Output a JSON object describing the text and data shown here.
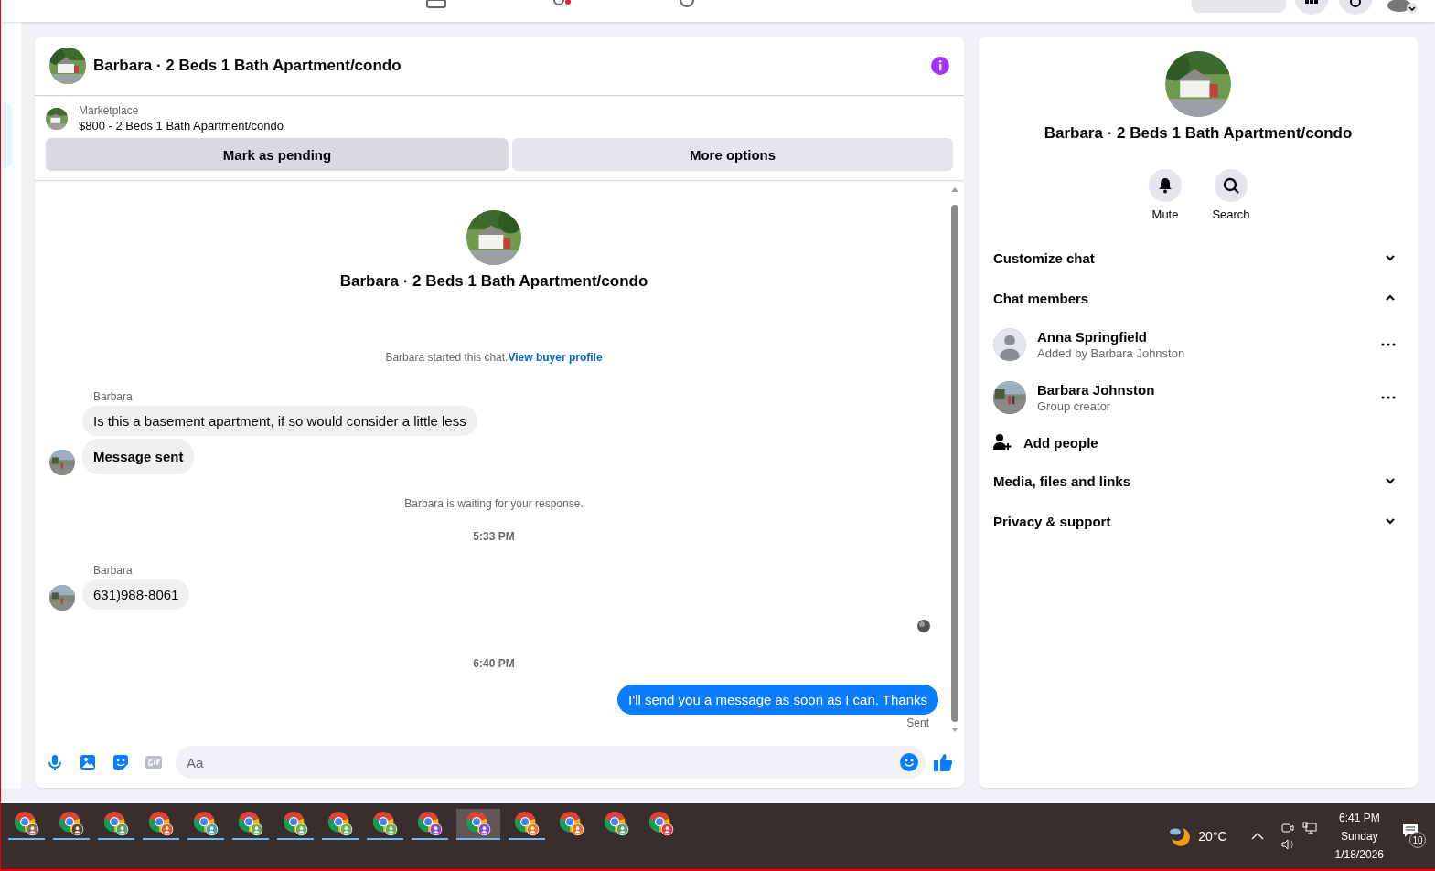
{
  "chat": {
    "title": "Barbara · 2 Beds 1 Bath Apartment/condo",
    "listing": {
      "source": "Marketplace",
      "summary": "$800 - 2 Beds 1 Bath Apartment/condo"
    },
    "actions": [
      {
        "label": "Mark as pending",
        "primary": true
      },
      {
        "label": "More options",
        "primary": false
      }
    ],
    "intro_title": "Barbara · 2 Beds 1 Bath Apartment/condo",
    "messages": [
      {
        "kind": "system",
        "text": "Barbara started this chat.",
        "link": "View buyer profile"
      },
      {
        "kind": "sender",
        "text": "Barbara"
      },
      {
        "kind": "received",
        "text": "Is this a basement apartment, if so would consider a little less"
      },
      {
        "kind": "received",
        "text": "Message sent",
        "bold": true
      },
      {
        "kind": "system",
        "text": "Barbara is waiting for your response."
      },
      {
        "kind": "time",
        "text": "5:33 PM"
      },
      {
        "kind": "sender",
        "text": "Barbara"
      },
      {
        "kind": "received",
        "text": "631)988-8061"
      },
      {
        "kind": "seen"
      },
      {
        "kind": "time",
        "text": "6:40 PM"
      },
      {
        "kind": "sent",
        "text": "I'll send you a message as soon as I can. Thanks"
      },
      {
        "kind": "status",
        "text": "Sent"
      }
    ],
    "composer": {
      "value": "Aa"
    }
  },
  "details": {
    "title": "Barbara · 2 Beds 1 Bath Apartment/condo",
    "quick_actions": [
      {
        "label": "Mute",
        "kind": "bell"
      },
      {
        "label": "Search",
        "kind": "search"
      }
    ],
    "sections": [
      {
        "label": "Customize chat",
        "expanded": false
      },
      {
        "label": "Chat members",
        "expanded": true,
        "members": [
          {
            "name": "Anna Springfield",
            "note": "Added by Barbara Johnston",
            "photo": false
          },
          {
            "name": "Barbara Johnston",
            "note": "Group creator",
            "photo": true
          }
        ],
        "add_label": "Add people"
      },
      {
        "label": "Media, files and links",
        "expanded": false
      },
      {
        "label": "Privacy & support",
        "expanded": false
      }
    ]
  },
  "taskbar": {
    "apps": [
      {
        "running": true,
        "selected": false,
        "color": "#8a6a50"
      },
      {
        "running": true,
        "selected": false,
        "color": "#5a4030"
      },
      {
        "running": true,
        "selected": false,
        "color": "#5aa06a"
      },
      {
        "running": true,
        "selected": false,
        "color": "#e05a3a"
      },
      {
        "running": true,
        "selected": false,
        "color": "#4aa0b0"
      },
      {
        "running": true,
        "selected": false,
        "color": "#6ab05a"
      },
      {
        "running": true,
        "selected": false,
        "color": "#6ab05a"
      },
      {
        "running": true,
        "selected": false,
        "color": "#6ab05a"
      },
      {
        "running": true,
        "selected": false,
        "color": "#6ab05a"
      },
      {
        "running": true,
        "selected": false,
        "color": "#8a4ad0"
      },
      {
        "running": true,
        "selected": true,
        "color": "#8a4ad0"
      },
      {
        "running": true,
        "selected": false,
        "color": "#e07a2a"
      },
      {
        "running": false,
        "selected": false,
        "color": "#e07a2a"
      },
      {
        "running": false,
        "selected": false,
        "color": "#5aa06a"
      },
      {
        "running": false,
        "selected": false,
        "color": "#e03a4a"
      }
    ],
    "weather": "20°C",
    "time": "6:41 PM",
    "day": "Sunday",
    "date": "1/18/2026",
    "notifications": "10"
  }
}
